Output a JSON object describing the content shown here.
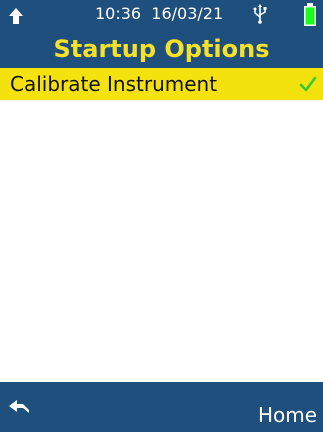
{
  "status_bar": {
    "time": "10:36",
    "date": "16/03/21",
    "icons": [
      "up-arrow-icon",
      "usb-icon",
      "battery-icon"
    ],
    "battery_color": "#1aff1a"
  },
  "header": {
    "title": "Startup Options",
    "title_color": "#f5e12a",
    "background_color": "#1f4f7c"
  },
  "options": [
    {
      "label": "Calibrate Instrument",
      "checked": true,
      "selected": true
    }
  ],
  "footer": {
    "back_icon": "back-arrow-icon",
    "home_label": "Home"
  },
  "colors": {
    "selection": "#f4e20f",
    "check": "#33cc33"
  }
}
